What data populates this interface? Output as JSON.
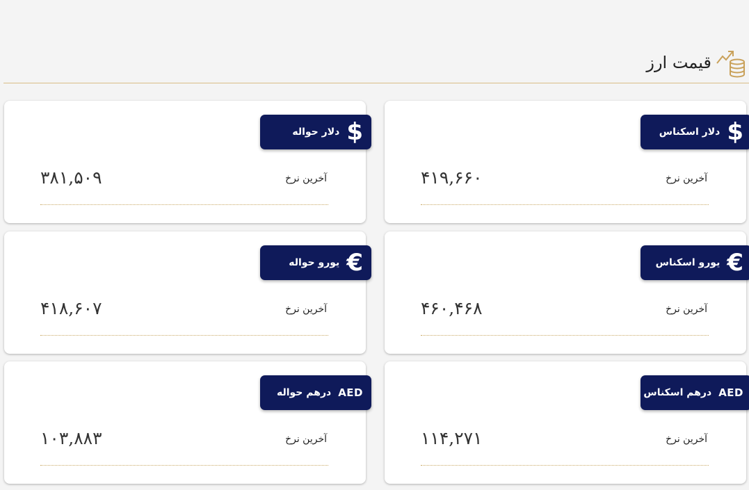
{
  "section": {
    "title": "قیمت ارز",
    "icon": "coins-trend-icon"
  },
  "cards": [
    {
      "label": "دلار اسکناس",
      "icon": "$",
      "icon_name": "dollar-icon",
      "rate_label": "آخرین نرخ",
      "value": "۴۱۹,۶۶۰"
    },
    {
      "label": "دلار حواله",
      "icon": "$",
      "icon_name": "dollar-icon",
      "rate_label": "آخرین نرخ",
      "value": "۳۸۱,۵۰۹"
    },
    {
      "label": "یورو اسکناس",
      "icon": "€",
      "icon_name": "euro-icon",
      "rate_label": "آخرین نرخ",
      "value": "۴۶۰,۴۶۸"
    },
    {
      "label": "یورو حواله",
      "icon": "€",
      "icon_name": "euro-icon",
      "rate_label": "آخرین نرخ",
      "value": "۴۱۸,۶۰۷"
    },
    {
      "label": "درهم اسکناس",
      "icon": "AED",
      "icon_name": "aed-icon",
      "rate_label": "آخرین نرخ",
      "value": "۱۱۴,۲۷۱"
    },
    {
      "label": "درهم حواله",
      "icon": "AED",
      "icon_name": "aed-icon",
      "rate_label": "آخرین نرخ",
      "value": "۱۰۳,۸۸۳"
    }
  ],
  "colors": {
    "badge": "#0f1a5a",
    "accent_line": "#d8bd86",
    "icon_gold": "#c9a15a",
    "background": "#f4f4f4"
  }
}
